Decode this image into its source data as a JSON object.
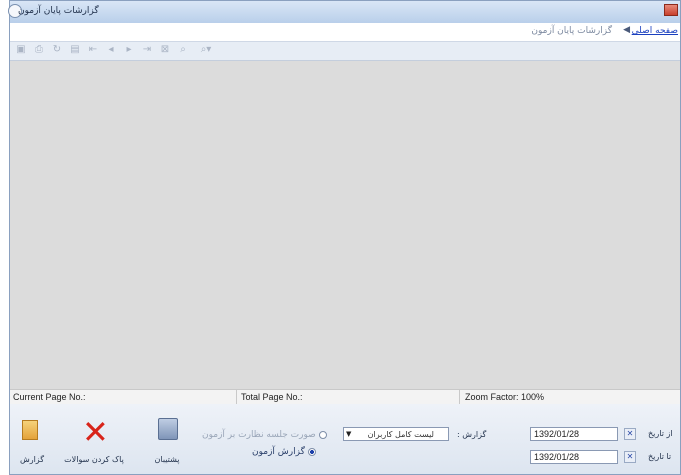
{
  "window": {
    "title": "گزارشات پایان آزمون"
  },
  "breadcrumb": {
    "home": "صفحه اصلی",
    "separator": "◀",
    "current": "گزارشات پایان آزمون"
  },
  "toolbar": {
    "icons": [
      "first-page-icon",
      "print-icon",
      "refresh-icon",
      "page-setup-icon",
      "first-icon",
      "prev-icon",
      "next-icon",
      "last-icon",
      "stop-icon",
      "find-icon",
      "zoom-icon"
    ]
  },
  "status": {
    "current_page": "Current Page No.:",
    "total_page": "Total Page No.:",
    "zoom": "Zoom Factor: 100%"
  },
  "actions": {
    "report_label": "گزارش",
    "clear_label": "پاک کردن سوالات",
    "backup_label": "پشتیبان"
  },
  "options": {
    "radio1_label": "صورت جلسه نظارت بر آزمون",
    "radio2_label": "گزارش آزمون"
  },
  "report_select": {
    "label": "گزارش :",
    "value": "لیست کامل کاربران"
  },
  "dates": {
    "from_label": "از تاریخ",
    "from_value": "1392/01/28",
    "to_label": "تا تاریخ",
    "to_value": "1392/01/28"
  },
  "colors": {
    "close": "#c8402d",
    "link": "#1a3fbf",
    "clear_icon": "#d8241a"
  }
}
